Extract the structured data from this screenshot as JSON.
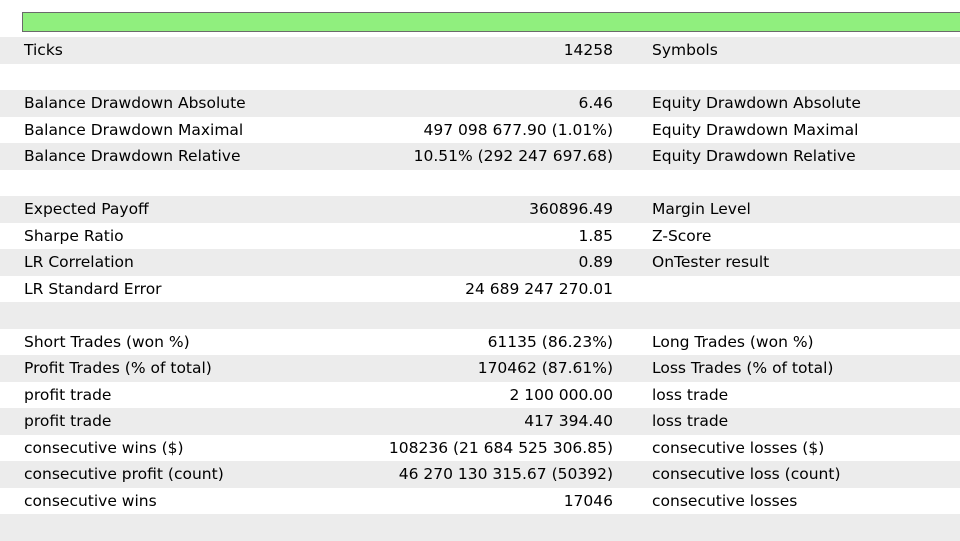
{
  "progress": {
    "fraction": 1.0,
    "color": "#90ef7e"
  },
  "colors": {
    "row_alt": "#ececec",
    "row_plain": "#ffffff"
  },
  "rows": [
    {
      "label": "Ticks",
      "value": "14258",
      "label2": "Symbols"
    },
    {
      "label": "",
      "value": "",
      "label2": ""
    },
    {
      "label": "Balance Drawdown Absolute",
      "value": "6.46",
      "label2": "Equity Drawdown Absolute"
    },
    {
      "label": "Balance Drawdown Maximal",
      "value": "497 098 677.90 (1.01%)",
      "label2": "Equity Drawdown Maximal"
    },
    {
      "label": "Balance Drawdown Relative",
      "value": "10.51% (292 247 697.68)",
      "label2": "Equity Drawdown Relative"
    },
    {
      "label": "",
      "value": "",
      "label2": ""
    },
    {
      "label": "Expected Payoff",
      "value": "360896.49",
      "label2": "Margin Level"
    },
    {
      "label": "Sharpe Ratio",
      "value": "1.85",
      "label2": "Z-Score"
    },
    {
      "label": "LR Correlation",
      "value": "0.89",
      "label2": "OnTester result"
    },
    {
      "label": "LR Standard Error",
      "value": "24 689 247 270.01",
      "label2": ""
    },
    {
      "label": "",
      "value": "",
      "label2": ""
    },
    {
      "label": "Short Trades (won %)",
      "value": "61135 (86.23%)",
      "label2": "Long Trades (won %)"
    },
    {
      "label": "Profit Trades (% of total)",
      "value": "170462 (87.61%)",
      "label2": "Loss Trades (% of total)"
    },
    {
      "label": "profit trade",
      "value": "2 100 000.00",
      "label2": "loss trade"
    },
    {
      "label": "profit trade",
      "value": "417 394.40",
      "label2": "loss trade"
    },
    {
      "label": "consecutive wins ($)",
      "value": "108236 (21 684 525 306.85)",
      "label2": "consecutive losses ($)"
    },
    {
      "label": "consecutive profit (count)",
      "value": "46 270 130 315.67 (50392)",
      "label2": "consecutive loss (count)"
    },
    {
      "label": "consecutive wins",
      "value": "17046",
      "label2": "consecutive losses"
    },
    {
      "label": "",
      "value": "",
      "label2": ""
    }
  ]
}
